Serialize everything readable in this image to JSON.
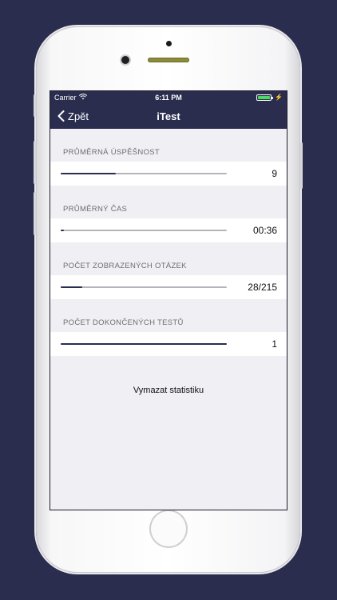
{
  "status_bar": {
    "carrier": "Carrier",
    "time": "6:11 PM"
  },
  "nav": {
    "back_label": "Zpět",
    "title": "iTest"
  },
  "stats": [
    {
      "header": "PRŮMĚRNÁ ÚSPĚŠNOST",
      "value": "9",
      "progress": 0.33
    },
    {
      "header": "PRŮMĚRNÝ ČAS",
      "value": "00:36",
      "progress": 0.02
    },
    {
      "header": "POČET ZOBRAZENÝCH OTÁZEK",
      "value": "28/215",
      "progress": 0.13
    },
    {
      "header": "POČET DOKONČENÝCH TESTŮ",
      "value": "1",
      "progress": 1.0
    }
  ],
  "clear_button": "Vymazat statistiku",
  "colors": {
    "nav_bg": "#2b2d4f",
    "accent": "#2b2d4f",
    "battery": "#4cd964"
  }
}
